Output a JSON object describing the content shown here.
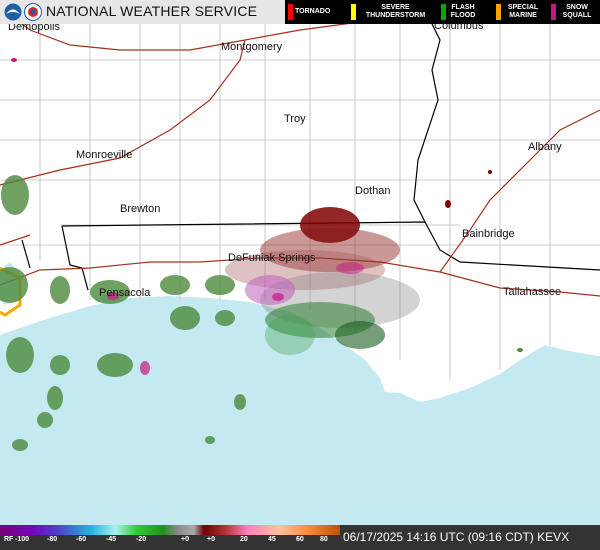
{
  "header": {
    "agency": "NATIONAL WEATHER SERVICE",
    "logos": [
      "noaa-logo",
      "nws-logo"
    ]
  },
  "legend": [
    {
      "label": "TORNADO",
      "color": "#ff0000"
    },
    {
      "label": "SEVERE THUNDERSTORM",
      "color": "#ffff00"
    },
    {
      "label": "FLASH FLOOD",
      "color": "#00aa00"
    },
    {
      "label": "SPECIAL MARINE",
      "color": "#ffa500"
    },
    {
      "label": "SNOW SQUALL",
      "color": "#c71585"
    }
  ],
  "map": {
    "cities": [
      "Demopolis",
      "Montgomery",
      "Columbus",
      "Troy",
      "Monroeville",
      "Albany",
      "Dothan",
      "Brewton",
      "Bainbridge",
      "DeFuniak Springs",
      "Pensacola",
      "Tallahassee"
    ],
    "colors": {
      "land": "#ffffff",
      "water": "#c4e9f0",
      "county": "#bbbbbb",
      "state": "#000000",
      "highway": "#a0321e"
    }
  },
  "scale": {
    "prefix": "RF",
    "ticks": [
      "-100",
      "-80",
      "-60",
      "-45",
      "-20",
      "+0",
      "+0",
      "20",
      "45",
      "60",
      "80",
      "100"
    ]
  },
  "footer": {
    "timestamp": "06/17/2025 14:16 UTC (09:16 CDT) KEVX"
  }
}
